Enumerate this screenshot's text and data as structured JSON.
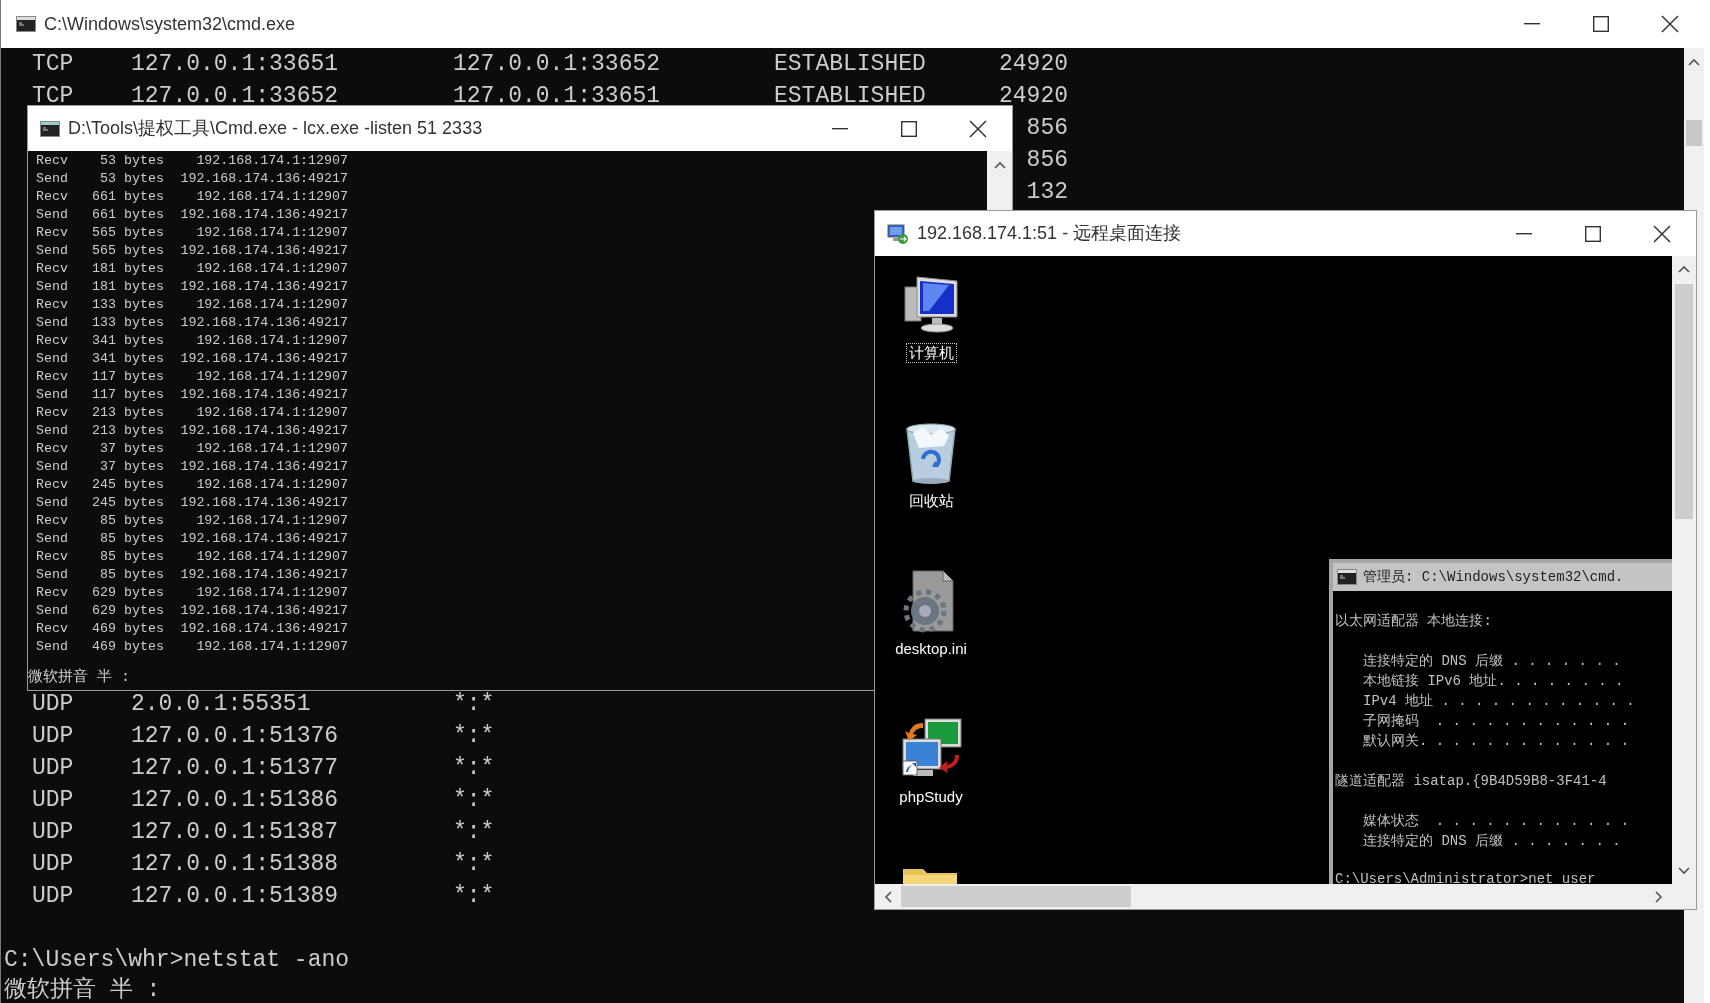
{
  "main_window": {
    "title": "C:\\Windows\\system32\\cmd.exe",
    "connections": [
      {
        "protocol": "TCP",
        "local": "127.0.0.1:33651",
        "foreign": "127.0.0.1:33652",
        "state": "ESTABLISHED",
        "pid": "24920"
      },
      {
        "protocol": "TCP",
        "local": "127.0.0.1:33652",
        "foreign": "127.0.0.1:33651",
        "state": "ESTABLISHED",
        "pid": "24920"
      },
      {
        "pid": "856"
      },
      {
        "pid": "856"
      },
      {
        "pid": "132"
      }
    ],
    "udp_connections": [
      {
        "protocol": "UDP",
        "local": "2.0.0.1:55351",
        "foreign": "*:*"
      },
      {
        "protocol": "UDP",
        "local": "127.0.0.1:51376",
        "foreign": "*:*"
      },
      {
        "protocol": "UDP",
        "local": "127.0.0.1:51377",
        "foreign": "*:*"
      },
      {
        "protocol": "UDP",
        "local": "127.0.0.1:51386",
        "foreign": "*:*"
      },
      {
        "protocol": "UDP",
        "local": "127.0.0.1:51387",
        "foreign": "*:*"
      },
      {
        "protocol": "UDP",
        "local": "127.0.0.1:51388",
        "foreign": "*:*"
      },
      {
        "protocol": "UDP",
        "local": "127.0.0.1:51389",
        "foreign": "*:*"
      }
    ],
    "prompt": "C:\\Users\\whr>netstat -ano",
    "ime_status": "微软拼音 半 :"
  },
  "lcx_window": {
    "title": "D:\\Tools\\提权工具\\Cmd.exe - lcx.exe -listen 51 2333",
    "rows": [
      {
        "direction": "Recv",
        "size": "53",
        "unit": "bytes",
        "address": "192.168.174.1:12907"
      },
      {
        "direction": "Send",
        "size": "53",
        "unit": "bytes",
        "address": "192.168.174.136:49217"
      },
      {
        "direction": "Recv",
        "size": "661",
        "unit": "bytes",
        "address": "192.168.174.1:12907"
      },
      {
        "direction": "Send",
        "size": "661",
        "unit": "bytes",
        "address": "192.168.174.136:49217"
      },
      {
        "direction": "Recv",
        "size": "565",
        "unit": "bytes",
        "address": "192.168.174.1:12907"
      },
      {
        "direction": "Send",
        "size": "565",
        "unit": "bytes",
        "address": "192.168.174.136:49217"
      },
      {
        "direction": "Recv",
        "size": "181",
        "unit": "bytes",
        "address": "192.168.174.1:12907"
      },
      {
        "direction": "Send",
        "size": "181",
        "unit": "bytes",
        "address": "192.168.174.136:49217"
      },
      {
        "direction": "Recv",
        "size": "133",
        "unit": "bytes",
        "address": "192.168.174.1:12907"
      },
      {
        "direction": "Send",
        "size": "133",
        "unit": "bytes",
        "address": "192.168.174.136:49217"
      },
      {
        "direction": "Recv",
        "size": "341",
        "unit": "bytes",
        "address": "192.168.174.1:12907"
      },
      {
        "direction": "Send",
        "size": "341",
        "unit": "bytes",
        "address": "192.168.174.136:49217"
      },
      {
        "direction": "Recv",
        "size": "117",
        "unit": "bytes",
        "address": "192.168.174.1:12907"
      },
      {
        "direction": "Send",
        "size": "117",
        "unit": "bytes",
        "address": "192.168.174.136:49217"
      },
      {
        "direction": "Recv",
        "size": "213",
        "unit": "bytes",
        "address": "192.168.174.1:12907"
      },
      {
        "direction": "Send",
        "size": "213",
        "unit": "bytes",
        "address": "192.168.174.136:49217"
      },
      {
        "direction": "Recv",
        "size": "37",
        "unit": "bytes",
        "address": "192.168.174.1:12907"
      },
      {
        "direction": "Send",
        "size": "37",
        "unit": "bytes",
        "address": "192.168.174.136:49217"
      },
      {
        "direction": "Recv",
        "size": "245",
        "unit": "bytes",
        "address": "192.168.174.1:12907"
      },
      {
        "direction": "Send",
        "size": "245",
        "unit": "bytes",
        "address": "192.168.174.136:49217"
      },
      {
        "direction": "Recv",
        "size": "85",
        "unit": "bytes",
        "address": "192.168.174.1:12907"
      },
      {
        "direction": "Send",
        "size": "85",
        "unit": "bytes",
        "address": "192.168.174.136:49217"
      },
      {
        "direction": "Recv",
        "size": "85",
        "unit": "bytes",
        "address": "192.168.174.1:12907"
      },
      {
        "direction": "Send",
        "size": "85",
        "unit": "bytes",
        "address": "192.168.174.136:49217"
      },
      {
        "direction": "Recv",
        "size": "629",
        "unit": "bytes",
        "address": "192.168.174.1:12907"
      },
      {
        "direction": "Send",
        "size": "629",
        "unit": "bytes",
        "address": "192.168.174.136:49217"
      },
      {
        "direction": "Recv",
        "size": "469",
        "unit": "bytes",
        "address": "192.168.174.136:49217"
      },
      {
        "direction": "Send",
        "size": "469",
        "unit": "bytes",
        "address": "192.168.174.1:12907"
      }
    ],
    "ime_status": "微软拼音 半 :"
  },
  "rdp_window": {
    "title": "192.168.174.1:51 - 远程桌面连接",
    "desktop_icons": [
      {
        "kind": "computer",
        "label": "计算机",
        "selected": true
      },
      {
        "kind": "recycle_bin",
        "label": "回收站",
        "selected": false
      },
      {
        "kind": "settings_file",
        "label": "desktop.ini",
        "selected": false
      },
      {
        "kind": "network_app",
        "label": "phpStudy",
        "selected": false
      },
      {
        "kind": "folder"
      }
    ],
    "inner_cmd": {
      "title": "管理员: C:\\Windows\\system32\\cmd.",
      "lines": [
        {
          "kind": "heading",
          "text": "以太网适配器 本地连接:"
        },
        {
          "kind": "item",
          "text": "连接特定的 DNS 后缀 . . . . . . ."
        },
        {
          "kind": "item",
          "text": "本地链接 IPv6 地址. . . . . . . ."
        },
        {
          "kind": "item",
          "text": "IPv4 地址 . . . . . . . . . . . ."
        },
        {
          "kind": "item",
          "text": "子网掩码  . . . . . . . . . . . ."
        },
        {
          "kind": "item",
          "text": "默认网关. . . . . . . . . . . . ."
        },
        {
          "kind": "heading",
          "text": "隧道适配器 isatap.{9B4D59B8-3F41-4"
        },
        {
          "kind": "item",
          "text": "媒体状态  . . . . . . . . . . . ."
        },
        {
          "kind": "item",
          "text": "连接特定的 DNS 后缀 . . . . . . ."
        },
        {
          "kind": "prompt",
          "text": "C:\\Users\\Administrator>net user"
        }
      ]
    }
  }
}
